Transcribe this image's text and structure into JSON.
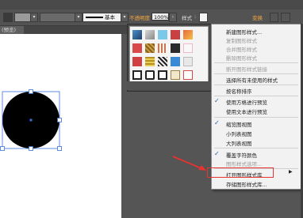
{
  "controlbar": {
    "stroke_label": "基本",
    "opacity_label": "不透明度",
    "opacity_value": "100%",
    "style_label": "样式",
    "transform_label": "变换"
  },
  "document": {
    "tab_label": "(预览)"
  },
  "menu": {
    "items": [
      {
        "label": "新建图形样式...",
        "disabled": false
      },
      {
        "label": "复制图形样式",
        "disabled": true
      },
      {
        "label": "合并图形样式",
        "disabled": true
      },
      {
        "label": "删除图形样式",
        "disabled": true
      },
      {
        "label": "断开图形样式链接",
        "disabled": true
      },
      {
        "label": "选择所有未使用的样式",
        "disabled": false
      },
      {
        "label": "按名称排序",
        "disabled": false
      },
      {
        "label": "使用方格进行预览",
        "disabled": false,
        "checked": true
      },
      {
        "label": "使用文本进行预览",
        "disabled": false
      },
      {
        "label": "缩览图视图",
        "disabled": false,
        "checked": true
      },
      {
        "label": "小列表视图",
        "disabled": false
      },
      {
        "label": "大列表视图",
        "disabled": false
      },
      {
        "label": "覆盖字符颜色",
        "disabled": false,
        "checked": true
      },
      {
        "label": "图形样式选项...",
        "disabled": true
      },
      {
        "label": "打开图形样式库",
        "disabled": false,
        "submenu": true
      },
      {
        "label": "存储图形样式库...",
        "disabled": false
      }
    ]
  },
  "colors": {
    "highlight_box": "#e8322f",
    "annotation_arrow": "#e8322f",
    "check_mark": "#1a5fb4",
    "circle_fill": "#000000",
    "selection_blue": "#3a6fd8"
  },
  "icons": {
    "arrow": "annotation-arrow",
    "submenu": "chevron-right-icon",
    "check": "check-icon"
  }
}
